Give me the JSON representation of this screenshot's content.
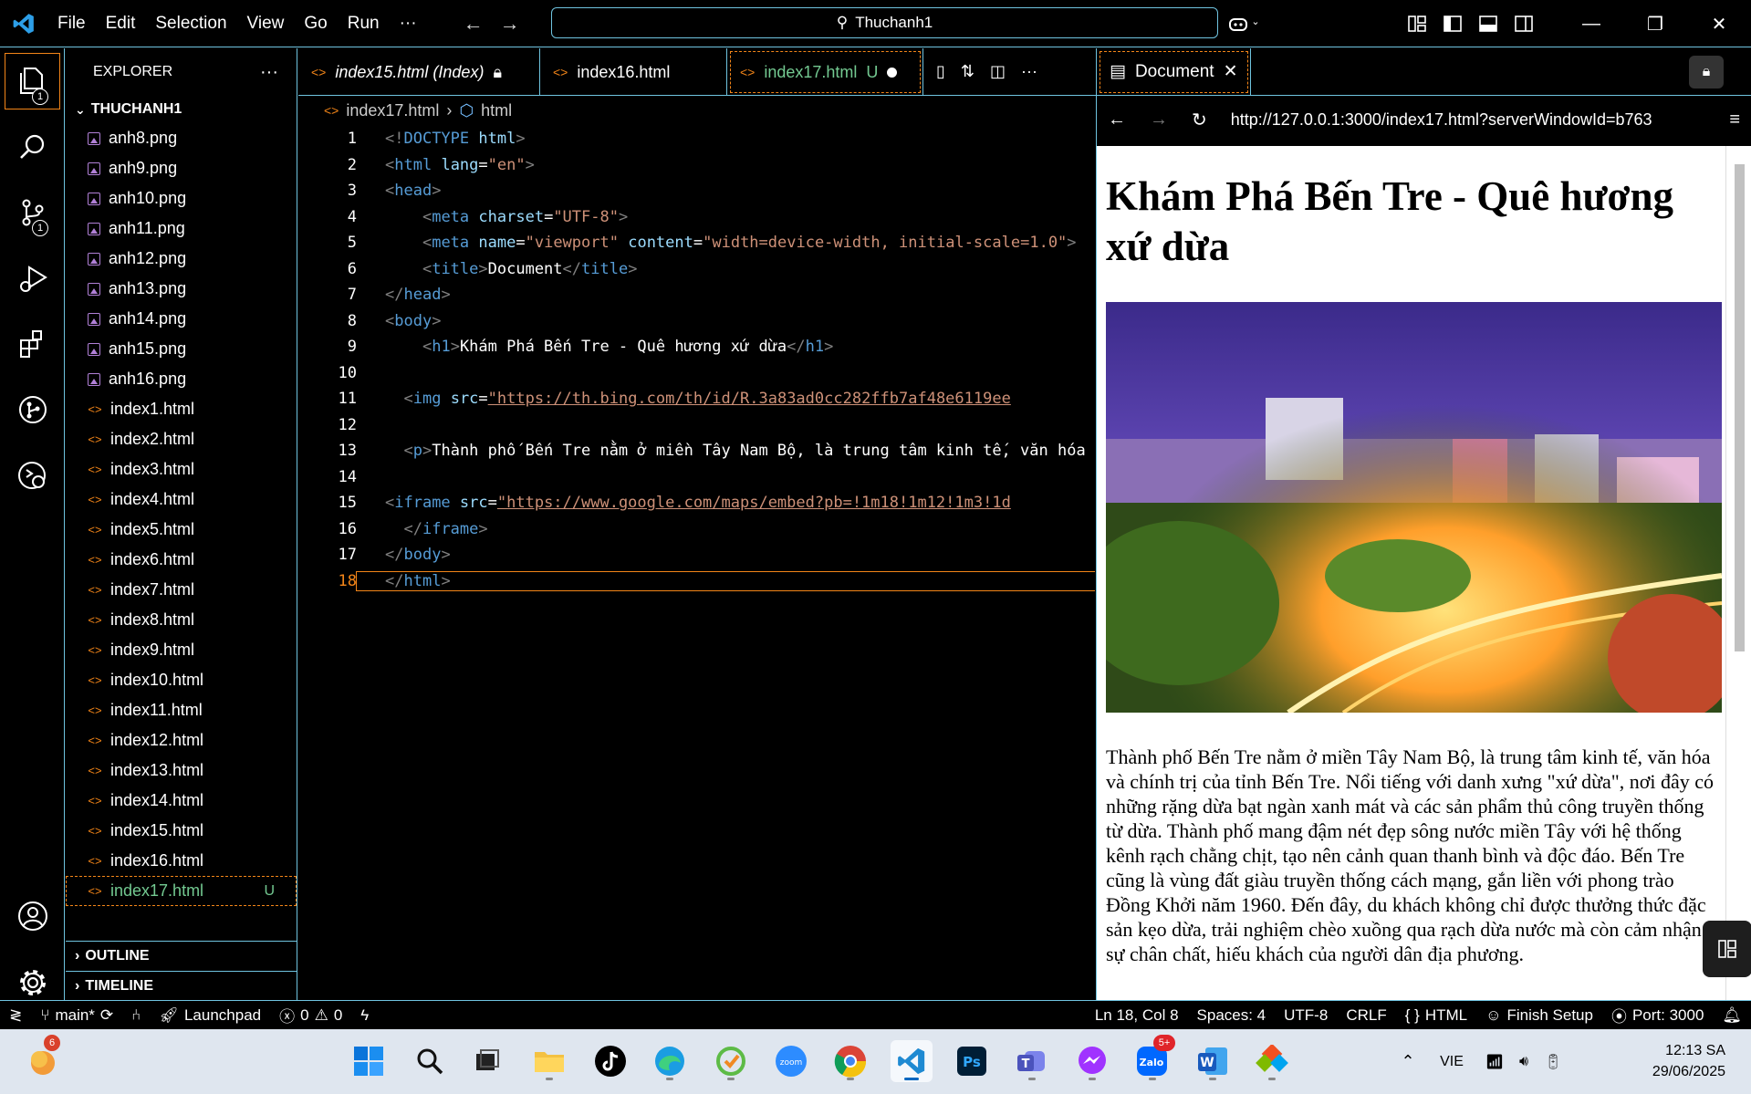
{
  "menu": [
    "File",
    "Edit",
    "Selection",
    "View",
    "Go",
    "Run",
    "···"
  ],
  "command_center": "Thuchanh1",
  "sidebar": {
    "header": "EXPLORER",
    "folder": "THUCHANH1",
    "files": [
      {
        "name": "anh8.png",
        "kind": "image"
      },
      {
        "name": "anh9.png",
        "kind": "image"
      },
      {
        "name": "anh10.png",
        "kind": "image"
      },
      {
        "name": "anh11.png",
        "kind": "image"
      },
      {
        "name": "anh12.png",
        "kind": "image"
      },
      {
        "name": "anh13.png",
        "kind": "image"
      },
      {
        "name": "anh14.png",
        "kind": "image"
      },
      {
        "name": "anh15.png",
        "kind": "image"
      },
      {
        "name": "anh16.png",
        "kind": "image"
      },
      {
        "name": "index1.html",
        "kind": "html"
      },
      {
        "name": "index2.html",
        "kind": "html"
      },
      {
        "name": "index3.html",
        "kind": "html"
      },
      {
        "name": "index4.html",
        "kind": "html"
      },
      {
        "name": "index5.html",
        "kind": "html"
      },
      {
        "name": "index6.html",
        "kind": "html"
      },
      {
        "name": "index7.html",
        "kind": "html"
      },
      {
        "name": "index8.html",
        "kind": "html"
      },
      {
        "name": "index9.html",
        "kind": "html"
      },
      {
        "name": "index10.html",
        "kind": "html"
      },
      {
        "name": "index11.html",
        "kind": "html"
      },
      {
        "name": "index12.html",
        "kind": "html"
      },
      {
        "name": "index13.html",
        "kind": "html"
      },
      {
        "name": "index14.html",
        "kind": "html"
      },
      {
        "name": "index15.html",
        "kind": "html"
      },
      {
        "name": "index16.html",
        "kind": "html"
      },
      {
        "name": "index17.html",
        "kind": "html",
        "status": "U",
        "active": true
      }
    ],
    "outline": "OUTLINE",
    "timeline": "TIMELINE"
  },
  "activity_badges": {
    "explorer": "1",
    "source_control": "1"
  },
  "tabs": [
    {
      "label": "index15.html (Index)",
      "italic": true,
      "lock": true
    },
    {
      "label": "index16.html"
    },
    {
      "label": "index17.html",
      "status": "U",
      "active": true,
      "dirty": true
    }
  ],
  "breadcrumb": {
    "file": "index17.html",
    "symbol": "html"
  },
  "code": {
    "current_line": 18,
    "lines": [
      [
        [
          "p",
          "<!"
        ],
        [
          "t",
          "DOCTYPE"
        ],
        [
          "txt",
          " "
        ],
        [
          "a",
          "html"
        ],
        [
          "p",
          ">"
        ]
      ],
      [
        [
          "p",
          "<"
        ],
        [
          "t",
          "html"
        ],
        [
          "txt",
          " "
        ],
        [
          "a",
          "lang"
        ],
        [
          "txt",
          "="
        ],
        [
          "s",
          "\"en\""
        ],
        [
          "p",
          ">"
        ]
      ],
      [
        [
          "p",
          "<"
        ],
        [
          "t",
          "head"
        ],
        [
          "p",
          ">"
        ]
      ],
      [
        [
          "txt",
          "    "
        ],
        [
          "p",
          "<"
        ],
        [
          "t",
          "meta"
        ],
        [
          "txt",
          " "
        ],
        [
          "a",
          "charset"
        ],
        [
          "txt",
          "="
        ],
        [
          "s",
          "\"UTF-8\""
        ],
        [
          "p",
          ">"
        ]
      ],
      [
        [
          "txt",
          "    "
        ],
        [
          "p",
          "<"
        ],
        [
          "t",
          "meta"
        ],
        [
          "txt",
          " "
        ],
        [
          "a",
          "name"
        ],
        [
          "txt",
          "="
        ],
        [
          "s",
          "\"viewport\""
        ],
        [
          "txt",
          " "
        ],
        [
          "a",
          "content"
        ],
        [
          "txt",
          "="
        ],
        [
          "s",
          "\"width=device-width, initial-scale=1.0\""
        ],
        [
          "p",
          ">"
        ]
      ],
      [
        [
          "txt",
          "    "
        ],
        [
          "p",
          "<"
        ],
        [
          "t",
          "title"
        ],
        [
          "p",
          ">"
        ],
        [
          "txt",
          "Document"
        ],
        [
          "p",
          "</"
        ],
        [
          "t",
          "title"
        ],
        [
          "p",
          ">"
        ]
      ],
      [
        [
          "p",
          "</"
        ],
        [
          "t",
          "head"
        ],
        [
          "p",
          ">"
        ]
      ],
      [
        [
          "p",
          "<"
        ],
        [
          "t",
          "body"
        ],
        [
          "p",
          ">"
        ]
      ],
      [
        [
          "txt",
          "    "
        ],
        [
          "p",
          "<"
        ],
        [
          "t",
          "h1"
        ],
        [
          "p",
          ">"
        ],
        [
          "txt",
          "Khám Phá Bến Tre - Quê hương xứ dừa"
        ],
        [
          "p",
          "</"
        ],
        [
          "t",
          "h1"
        ],
        [
          "p",
          ">"
        ]
      ],
      [],
      [
        [
          "txt",
          "  "
        ],
        [
          "p",
          "<"
        ],
        [
          "t",
          "img"
        ],
        [
          "txt",
          " "
        ],
        [
          "a",
          "src"
        ],
        [
          "txt",
          "="
        ],
        [
          "lnk",
          "\"https://th.bing.com/th/id/R.3a83ad0cc282ffb7af48e6119ee"
        ]
      ],
      [],
      [
        [
          "txt",
          "  "
        ],
        [
          "p",
          "<"
        ],
        [
          "t",
          "p"
        ],
        [
          "p",
          ">"
        ],
        [
          "txt",
          "Thành phố Bến Tre nằm ở miền Tây Nam Bộ, là trung tâm kinh tế, văn hóa"
        ]
      ],
      [],
      [
        [
          "p",
          "<"
        ],
        [
          "t",
          "iframe"
        ],
        [
          "txt",
          " "
        ],
        [
          "a",
          "src"
        ],
        [
          "txt",
          "="
        ],
        [
          "lnk",
          "\"https://www.google.com/maps/embed?pb=!1m18!1m12!1m3!1d"
        ]
      ],
      [
        [
          "txt",
          "  "
        ],
        [
          "p",
          "</"
        ],
        [
          "t",
          "iframe"
        ],
        [
          "p",
          ">"
        ]
      ],
      [
        [
          "p",
          "</"
        ],
        [
          "t",
          "body"
        ],
        [
          "p",
          ">"
        ]
      ],
      [
        [
          "p",
          "</"
        ],
        [
          "t",
          "html"
        ],
        [
          "p",
          ">"
        ]
      ]
    ]
  },
  "preview": {
    "tab_label": "Document",
    "url": "http://127.0.0.1:3000/index17.html?serverWindowId=b763",
    "heading": "Khám Phá Bến Tre - Quê hương xứ dừa",
    "paragraph": "Thành phố Bến Tre nằm ở miền Tây Nam Bộ, là trung tâm kinh tế, văn hóa và chính trị của tỉnh Bến Tre. Nổi tiếng với danh xưng \"xứ dừa\", nơi đây có những rặng dừa bạt ngàn xanh mát và các sản phẩm thủ công truyền thống từ dừa. Thành phố mang đậm nét đẹp sông nước miền Tây với hệ thống kênh rạch chằng chịt, tạo nên cảnh quan thanh bình và độc đáo. Bến Tre cũng là vùng đất giàu truyền thống cách mạng, gắn liền với phong trào Đồng Khởi năm 1960. Đến đây, du khách không chỉ được thưởng thức đặc sản kẹo dừa, trải nghiệm chèo xuồng qua rạch dừa nước mà còn cảm nhận sự chân chất, hiếu khách của người dân địa phương."
  },
  "status": {
    "branch": "main*",
    "launchpad": "Launchpad",
    "errors": "0",
    "warnings": "0",
    "position": "Ln 18, Col 8",
    "spaces": "Spaces: 4",
    "encoding": "UTF-8",
    "eol": "CRLF",
    "language": "HTML",
    "finish_setup": "Finish Setup",
    "port": "Port: 3000"
  },
  "taskbar": {
    "widget_badge": "6",
    "zalo_badge": "5+",
    "language": "VIE",
    "time": "12:13 SA",
    "date": "29/06/2025"
  },
  "colors": {
    "accent": "#6fc3df",
    "focus": "#f38518",
    "untracked": "#73c991"
  }
}
